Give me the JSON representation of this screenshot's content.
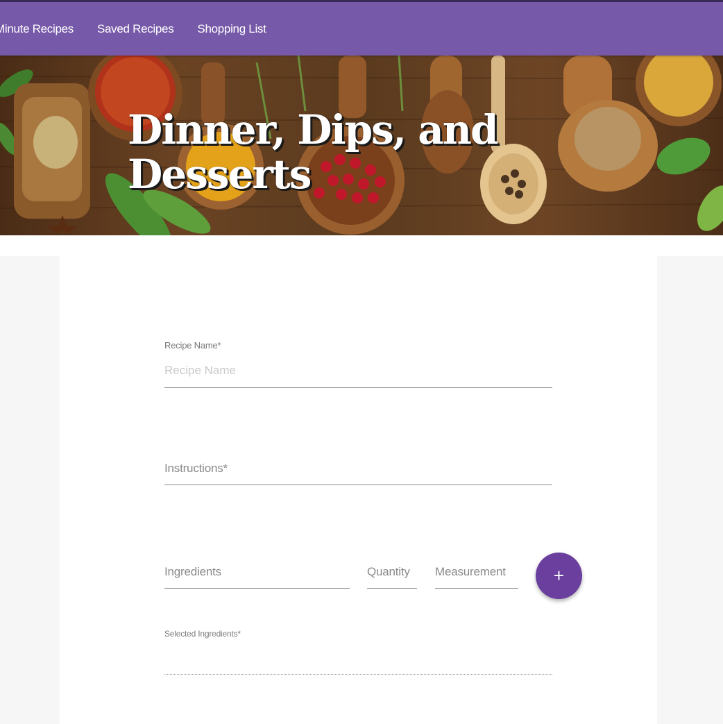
{
  "nav": {
    "links": [
      {
        "label": "Minute Recipes"
      },
      {
        "label": "Saved Recipes"
      },
      {
        "label": "Shopping List"
      }
    ],
    "background_color": "#7659a8"
  },
  "hero": {
    "title_line1": "Dinner, Dips, and",
    "title_line2": "Desserts"
  },
  "form": {
    "recipe_name": {
      "label": "Recipe Name*",
      "placeholder": "Recipe Name",
      "value": ""
    },
    "instructions": {
      "label": "Instructions*",
      "value": ""
    },
    "ingredients": {
      "label": "Ingredients",
      "value": ""
    },
    "quantity": {
      "label": "Quantity",
      "value": ""
    },
    "measurement": {
      "label": "Measurement",
      "value": ""
    },
    "add_button": {
      "icon": "plus-icon",
      "glyph": "+",
      "color": "#6a3f9e"
    },
    "selected_ingredients": {
      "label": "Selected Ingredients*",
      "items": []
    }
  }
}
